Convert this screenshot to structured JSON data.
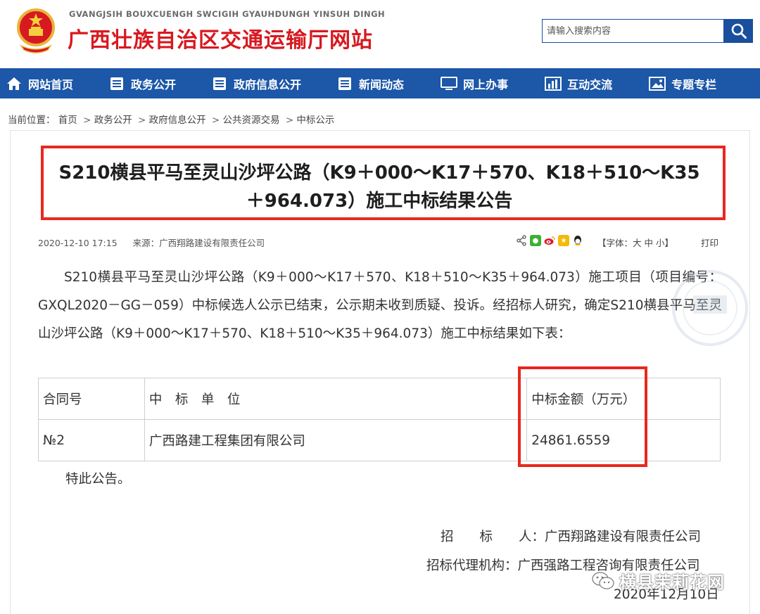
{
  "header": {
    "site_name_en": "GVANGJSIH BOUXCUENGH SWCIGIH GYAUHDUNGH YINSUH DINGH",
    "site_name_cn": "广西壮族自治区交通运输厅网站",
    "search_placeholder": "请输入搜索内容"
  },
  "nav": {
    "items": [
      {
        "label": "网站首页",
        "icon": "home-icon"
      },
      {
        "label": "政务公开",
        "icon": "document-icon"
      },
      {
        "label": "政府信息公开",
        "icon": "document-icon"
      },
      {
        "label": "新闻动态",
        "icon": "document-icon"
      },
      {
        "label": "网上办事",
        "icon": "monitor-icon"
      },
      {
        "label": "互动交流",
        "icon": "bar-chart-icon"
      },
      {
        "label": "专题专栏",
        "icon": "image-icon"
      }
    ],
    "bg_color": "#1c57a8"
  },
  "breadcrumb": {
    "prefix": "当前位置：",
    "items": [
      "首页",
      "政务公开",
      "政府信息公开",
      "公共资源交易",
      "中标公示"
    ],
    "separator": ">"
  },
  "article": {
    "title": "S210横县平马至灵山沙坪公路（K9＋000～K17＋570、K18＋510～K35＋964.073）施工中标结果公告",
    "date": "2020-12-10 17:15",
    "source": "来源：广西翔路建设有限责任公司",
    "font_size_label": "【字体：大 中 小】",
    "print_label": "打印",
    "body": "S210横县平马至灵山沙坪公路（K9＋000～K17＋570、K18＋510～K35＋964.073）施工项目（项目编号：GXQL2020－GG－059）中标候选人公示已结束，公示期未收到质疑、投诉。经招标人研究，确定S210横县平马至灵山沙坪公路（K9＋000～K17＋570、K18＋510～K35＋964.073）施工中标结果如下表：",
    "table": {
      "headers": [
        "合同号",
        "中　标　单　位",
        "中标金额（万元）"
      ],
      "rows": [
        [
          "№2",
          "广西路建工程集团有限公司",
          "24861.6559"
        ]
      ]
    },
    "note": "特此公告。",
    "tenderer_label": "招　　标　　人：",
    "tenderer": "广西翔路建设有限责任公司",
    "agent_label": "招标代理机构：",
    "agent": "广西强路工程咨询有限责任公司",
    "sign_date": "2020年12月10日"
  },
  "watermarks": {
    "wechat": "横县茉莉花网"
  },
  "colors": {
    "site_name": "#d71920",
    "highlight_box": "#e8281f"
  }
}
